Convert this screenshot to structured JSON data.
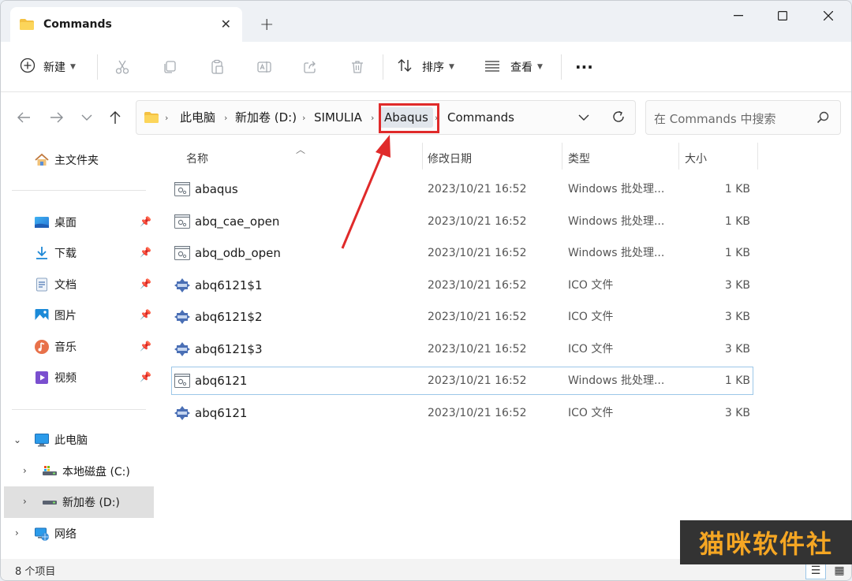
{
  "window": {
    "tab_title": "Commands",
    "new_tab": "+",
    "controls": {
      "minimize": "minimize-icon",
      "maximize": "maximize-icon",
      "close": "close-icon"
    }
  },
  "toolbar": {
    "new_label": "新建",
    "sort_label": "排序",
    "view_label": "查看",
    "more_label": "···"
  },
  "address": {
    "crumbs": [
      "此电脑",
      "新加卷 (D:)",
      "SIMULIA",
      "Abaqus",
      "Commands"
    ],
    "search_placeholder": "在 Commands 中搜索"
  },
  "sidebar": {
    "home": "主文件夹",
    "quick": [
      {
        "label": "桌面"
      },
      {
        "label": "下载"
      },
      {
        "label": "文档"
      },
      {
        "label": "图片"
      },
      {
        "label": "音乐"
      },
      {
        "label": "视频"
      }
    ],
    "this_pc": "此电脑",
    "drive_c": "本地磁盘 (C:)",
    "drive_d": "新加卷 (D:)",
    "network": "网络"
  },
  "columns": {
    "name": "名称",
    "date": "修改日期",
    "type": "类型",
    "size": "大小"
  },
  "files": [
    {
      "name": "abaqus",
      "date": "2023/10/21 16:52",
      "type": "Windows 批处理...",
      "size": "1 KB",
      "icon": "batch-file-icon"
    },
    {
      "name": "abq_cae_open",
      "date": "2023/10/21 16:52",
      "type": "Windows 批处理...",
      "size": "1 KB",
      "icon": "batch-file-icon"
    },
    {
      "name": "abq_odb_open",
      "date": "2023/10/21 16:52",
      "type": "Windows 批处理...",
      "size": "1 KB",
      "icon": "batch-file-icon"
    },
    {
      "name": "abq6121$1",
      "date": "2023/10/21 16:52",
      "type": "ICO 文件",
      "size": "3 KB",
      "icon": "ico-file-icon"
    },
    {
      "name": "abq6121$2",
      "date": "2023/10/21 16:52",
      "type": "ICO 文件",
      "size": "3 KB",
      "icon": "ico-file-icon"
    },
    {
      "name": "abq6121$3",
      "date": "2023/10/21 16:52",
      "type": "ICO 文件",
      "size": "3 KB",
      "icon": "ico-file-icon"
    },
    {
      "name": "abq6121",
      "date": "2023/10/21 16:52",
      "type": "Windows 批处理...",
      "size": "1 KB",
      "icon": "batch-file-icon",
      "selected": true
    },
    {
      "name": "abq6121",
      "date": "2023/10/21 16:52",
      "type": "ICO 文件",
      "size": "3 KB",
      "icon": "ico-file-icon"
    }
  ],
  "status": {
    "count_text": "8 个项目"
  },
  "watermark": {
    "text": "猫咪软件社"
  },
  "colors": {
    "highlight": "#e02a2a",
    "accent": "#0067c0"
  }
}
